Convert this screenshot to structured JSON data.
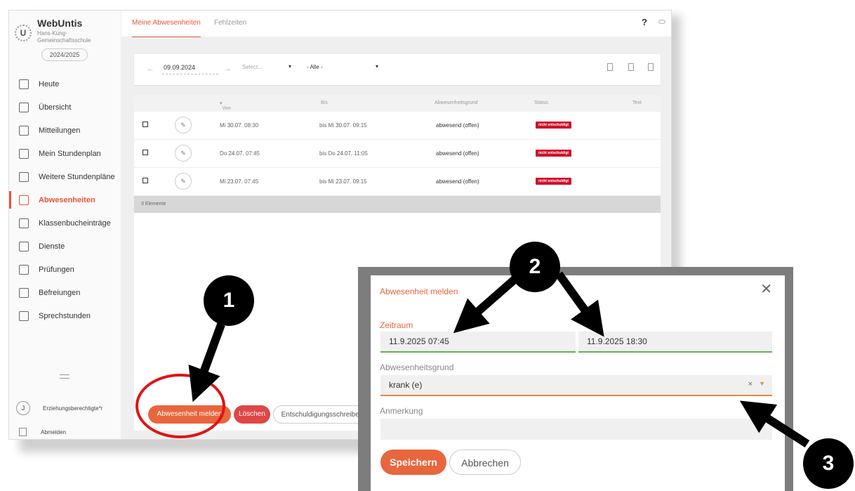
{
  "app": {
    "brand": "WebUntis",
    "school": "Hans-Küng-Gemeinschaftsschule",
    "school_year": "2024/2025",
    "logo_letter": "U"
  },
  "sidebar": {
    "items": [
      {
        "label": "Heute",
        "icon": "today-icon"
      },
      {
        "label": "Übersicht",
        "icon": "overview-icon"
      },
      {
        "label": "Mitteilungen",
        "icon": "mail-icon"
      },
      {
        "label": "Mein Stundenplan",
        "icon": "calendar-icon"
      },
      {
        "label": "Weitere Stundenpläne",
        "icon": "calendar-grid-icon"
      },
      {
        "label": "Abwesenheiten",
        "icon": "chair-icon",
        "active": true
      },
      {
        "label": "Klassenbucheinträge",
        "icon": "notebook-icon"
      },
      {
        "label": "Dienste",
        "icon": "service-icon"
      },
      {
        "label": "Prüfungen",
        "icon": "exam-icon"
      },
      {
        "label": "Befreiungen",
        "icon": "exemption-icon"
      },
      {
        "label": "Sprechstunden",
        "icon": "consultation-icon"
      }
    ],
    "user_initial": "J",
    "user_role": "Erziehungsberechtigte*r",
    "logout": "Abmelden"
  },
  "topbar": {
    "tabs": [
      "Meine Abwesenheiten",
      "Fehlzeiten"
    ],
    "help": "?"
  },
  "filters": {
    "date": "09.09.2024",
    "select_placeholder": "Select...",
    "status_value": "- Alle -"
  },
  "table": {
    "headers": [
      "Von",
      "Bis",
      "Abwesenheitsgrund",
      "Status",
      "Text"
    ],
    "rows": [
      {
        "from_day": "Mi",
        "from_date": "30.07.",
        "from_time": "08:30",
        "to_day": "bis Mi",
        "to_date": "30.07.",
        "to_time": "09:15",
        "reason": "abwesend (offen)",
        "status": "nicht entschuldigt"
      },
      {
        "from_day": "Do",
        "from_date": "24.07.",
        "from_time": "07:45",
        "to_day": "bis Do",
        "to_date": "24.07.",
        "to_time": "11:05",
        "reason": "abwesend (offen)",
        "status": "nicht entschuldigt"
      },
      {
        "from_day": "Mi",
        "from_date": "23.07.",
        "from_time": "07:45",
        "to_day": "bis Mi",
        "to_date": "23.07.",
        "to_time": "09:15",
        "reason": "abwesend (offen)",
        "status": "nicht entschuldigt"
      }
    ],
    "count": "3 Elemente"
  },
  "actions": {
    "report": "Abwesenheit melden",
    "delete": "Löschen",
    "excuse": "Entschuldigungsschreiben"
  },
  "modal": {
    "title": "Abwesenheit melden",
    "period_label": "Zeitraum",
    "start": "11.9.2025 07:45",
    "end": "11.9.2025 18:30",
    "reason_label": "Abwesenheitsgrund",
    "reason_value": "krank (e)",
    "clear": "×",
    "note_label": "Anmerkung",
    "note_value": "",
    "save": "Speichern",
    "cancel": "Abbrechen"
  },
  "annotations": {
    "callout_1": "1",
    "callout_2": "2",
    "callout_3": "3",
    "ring_color": "#e01414"
  },
  "colors": {
    "accent": "#e8663d",
    "danger": "#d0112b",
    "valid": "#5fb24f"
  }
}
